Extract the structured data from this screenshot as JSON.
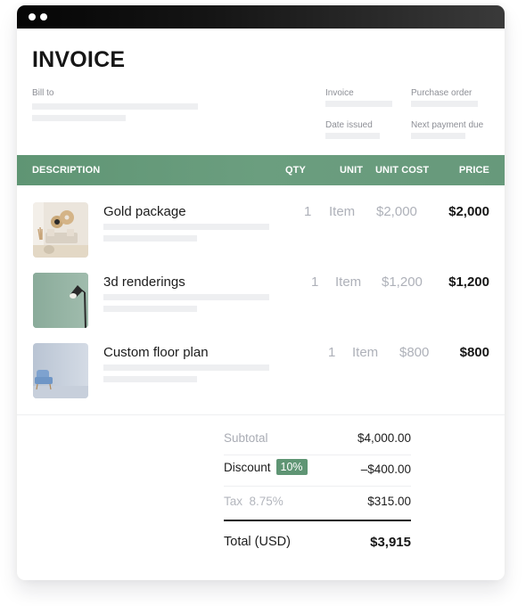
{
  "window": {
    "controls": [
      "dot",
      "dot"
    ]
  },
  "invoice": {
    "title": "INVOICE",
    "bill_to_label": "Bill to",
    "meta": {
      "invoice_label": "Invoice",
      "purchase_order_label": "Purchase order",
      "date_issued_label": "Date issued",
      "next_payment_due_label": "Next payment due"
    }
  },
  "table": {
    "columns": [
      "DESCRIPTION",
      "QTY",
      "UNIT",
      "UNIT COST",
      "PRICE"
    ],
    "accent_color": "#6b9e7f",
    "rows": [
      {
        "name": "Gold package",
        "qty": "1",
        "unit": "Item",
        "unit_cost": "$2,000",
        "price": "$2,000",
        "thumbnail": "living-room-image"
      },
      {
        "name": "3d renderings",
        "qty": "1",
        "unit": "Item",
        "unit_cost": "$1,200",
        "price": "$1,200",
        "thumbnail": "floor-lamp-image"
      },
      {
        "name": "Custom floor plan",
        "qty": "1",
        "unit": "Item",
        "unit_cost": "$800",
        "price": "$800",
        "thumbnail": "armchair-image"
      }
    ]
  },
  "totals": {
    "subtotal_label": "Subtotal",
    "subtotal_value": "$4,000.00",
    "discount_label": "Discount",
    "discount_badge": "10%",
    "discount_value": "–$400.00",
    "tax_label": "Tax",
    "tax_rate": "8.75%",
    "tax_value": "$315.00",
    "total_label": "Total (USD)",
    "total_value": "$3,915"
  }
}
